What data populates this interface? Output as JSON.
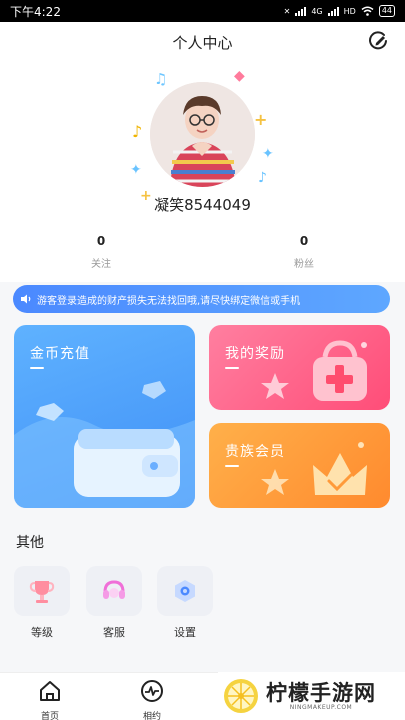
{
  "status_bar": {
    "time": "下午4:22",
    "network": "4G",
    "hd": "HD",
    "battery": "44"
  },
  "header": {
    "title": "个人中心",
    "action_icon": "edit-icon"
  },
  "profile": {
    "username": "凝笑8544049"
  },
  "stats": [
    {
      "value": "0",
      "label": "关注"
    },
    {
      "value": "0",
      "label": "粉丝"
    }
  ],
  "notice": {
    "icon": "speaker-icon",
    "text": "游客登录造成的财产损失无法找回哦,请尽快绑定微信或手机"
  },
  "cards": {
    "coin": {
      "title": "金币充值"
    },
    "reward": {
      "title": "我的奖励"
    },
    "noble": {
      "title": "贵族会员"
    }
  },
  "other": {
    "title": "其他",
    "items": [
      {
        "label": "等级",
        "icon": "trophy-icon"
      },
      {
        "label": "客服",
        "icon": "headset-icon"
      },
      {
        "label": "设置",
        "icon": "settings-icon"
      }
    ]
  },
  "tabs": [
    {
      "label": "首页",
      "icon": "home-icon"
    },
    {
      "label": "相约",
      "icon": "pulse-icon"
    }
  ],
  "watermark": {
    "text": "柠檬手游网",
    "url": "NINGMAKEUP.COM"
  },
  "colors": {
    "accent": "#4b89ff",
    "reward": "#ff5a80",
    "noble": "#ff9a3a"
  }
}
